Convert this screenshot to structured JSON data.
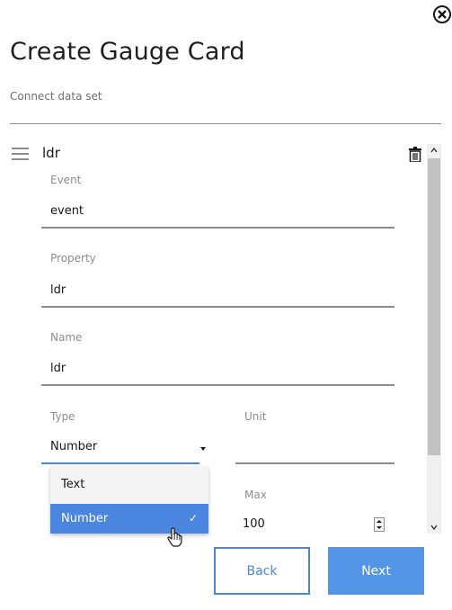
{
  "header": {
    "title": "Create Gauge Card",
    "subtitle": "Connect data set"
  },
  "dataset": {
    "name": "ldr",
    "fields": {
      "event": {
        "label": "Event",
        "value": "event"
      },
      "property": {
        "label": "Property",
        "value": "ldr"
      },
      "name": {
        "label": "Name",
        "value": "ldr"
      },
      "type": {
        "label": "Type",
        "value": "Number"
      },
      "unit": {
        "label": "Unit",
        "value": ""
      },
      "max": {
        "label": "Max",
        "value": "100"
      }
    }
  },
  "type_menu": {
    "options": [
      "Text",
      "Number"
    ],
    "selected": "Number",
    "check_mark": "✓"
  },
  "footer": {
    "back_label": "Back",
    "next_label": "Next"
  },
  "colors": {
    "accent": "#4a86e0",
    "primary_button": "#5595e8",
    "line": "#8d8d8d"
  },
  "icons": {
    "close": "close-circle-icon",
    "drag": "drag-handle-icon",
    "delete": "trash-icon",
    "dropdown": "caret-down-icon",
    "check": "checkmark-icon",
    "cursor": "hand-pointer-icon"
  }
}
